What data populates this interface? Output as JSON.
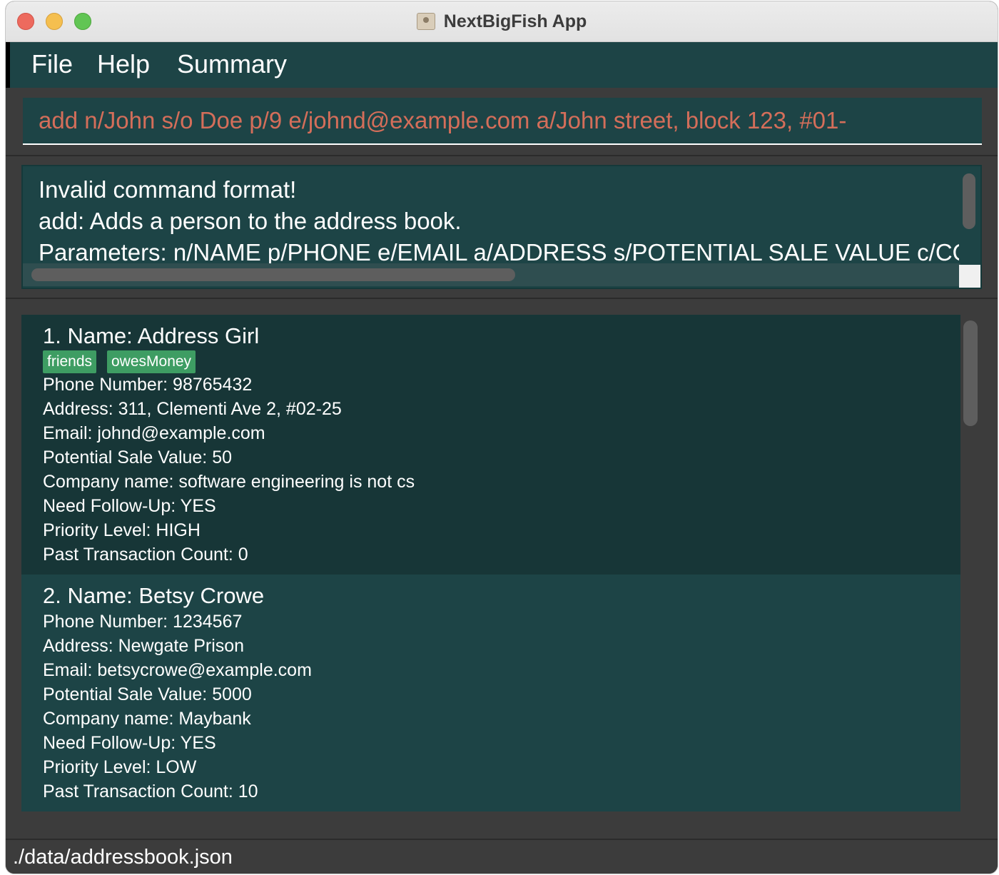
{
  "window": {
    "title": "NextBigFish App"
  },
  "menu": {
    "file": "File",
    "help": "Help",
    "summary": "Summary"
  },
  "command": {
    "value": "add n/John s/o Doe p/9 e/johnd@example.com a/John street, block 123, #01-"
  },
  "result": {
    "lines": [
      "Invalid command format!",
      "add: Adds a person to the address book.",
      "Parameters: n/NAME p/PHONE e/EMAIL a/ADDRESS s/POTENTIAL SALE VALUE c/COM"
    ]
  },
  "persons": [
    {
      "heading": "1.  Name: Address Girl",
      "tags": [
        "friends",
        "owesMoney"
      ],
      "phone": "Phone Number: 98765432",
      "address": "Address: 311, Clementi Ave 2, #02-25",
      "email": "Email: johnd@example.com",
      "sale_value": "Potential Sale Value: 50",
      "company": "Company name: software engineering is not cs",
      "follow_up": "Need Follow-Up: YES",
      "priority": "Priority Level: HIGH",
      "transactions": "Past Transaction Count: 0"
    },
    {
      "heading": "2.  Name: Betsy Crowe",
      "tags": [],
      "phone": "Phone Number: 1234567",
      "address": "Address: Newgate Prison",
      "email": "Email: betsycrowe@example.com",
      "sale_value": "Potential Sale Value: 5000",
      "company": "Company name: Maybank",
      "follow_up": "Need Follow-Up: YES",
      "priority": "Priority Level: LOW",
      "transactions": "Past Transaction Count: 10"
    }
  ],
  "status": {
    "file_path": "./data/addressbook.json"
  },
  "colors": {
    "panel": "#1d4446",
    "panel_selected": "#173637",
    "background": "#3c3c3c",
    "tag": "#3e9d63",
    "command_text": "#d46e5a"
  }
}
